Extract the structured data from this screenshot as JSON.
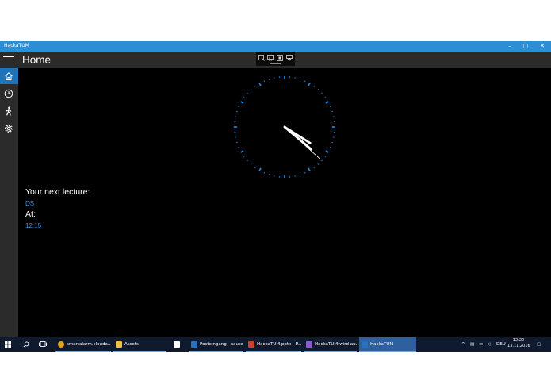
{
  "window": {
    "title": "HackaTUM",
    "minimize": "–",
    "maximize": "▢",
    "close": "✕"
  },
  "header": {
    "page_title": "Home"
  },
  "toolbar": {
    "icons": [
      "select-icon",
      "pointer-icon",
      "layout-icon",
      "inspect-icon"
    ]
  },
  "sidebar": {
    "items": [
      {
        "name": "home",
        "icon": "home-icon",
        "active": true
      },
      {
        "name": "clock",
        "icon": "clock-icon",
        "active": false
      },
      {
        "name": "walk",
        "icon": "walking-person-icon",
        "active": false
      },
      {
        "name": "settings",
        "icon": "gear-icon",
        "active": false
      }
    ]
  },
  "clock": {
    "time": {
      "hours": 4,
      "minutes": 20,
      "seconds": 22
    },
    "tick_color": "#1e8fe6",
    "hand_color": "#ffffff"
  },
  "lecture": {
    "next_label": "Your next lecture:",
    "name": "DS",
    "at_label": "At:",
    "time": "12:15"
  },
  "taskbar": {
    "items": [
      {
        "label": "smartalarm.clouda...",
        "color": "#e5a020"
      },
      {
        "label": "Assets",
        "color": "#f0c040"
      },
      {
        "label": "",
        "color": "#2a6fc0"
      },
      {
        "label": "Posteingang - saute...",
        "color": "#2a6fc0"
      },
      {
        "label": "HackaTUM.pptx - P...",
        "color": "#c8442e"
      },
      {
        "label": "HackaTUM(wird au...",
        "color": "#8a5ad0"
      },
      {
        "label": "HackaTUM",
        "color": "#2a6fc0"
      }
    ],
    "language": "DEU",
    "time": "12:20",
    "date": "13.11.2016"
  },
  "accent": "#2b8fd6"
}
